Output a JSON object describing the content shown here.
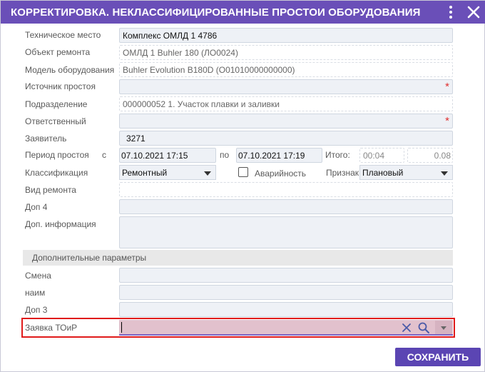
{
  "window": {
    "title": "КОРРЕКТИРОВКА. НЕКЛАССИФИЦИРОВАННЫЕ ПРОСТОИ ОБОРУДОВАНИЯ"
  },
  "fields": {
    "tech_place": {
      "label": "Техническое место",
      "value": "Комплекс ОМЛД 1 4786"
    },
    "repair_object": {
      "label": "Объект ремонта",
      "value": "ОМЛД 1 Buhler 180 (ЛО0024)"
    },
    "equipment_model": {
      "label": "Модель оборудования",
      "value": "Buhler Evolution B180D (O01010000000000)"
    },
    "downtime_source": {
      "label": "Источник простоя",
      "value": "",
      "required_mark": "*"
    },
    "department": {
      "label": "Подразделение",
      "value": "000000052 1. Участок плавки и заливки"
    },
    "responsible": {
      "label": "Ответственный",
      "value": "",
      "required_mark": "*"
    },
    "applicant": {
      "label": "Заявитель",
      "value": "3271"
    },
    "period": {
      "label": "Период простоя",
      "from_label": "с",
      "from_value": "07.10.2021 17:15",
      "to_label": "по",
      "to_value": "07.10.2021 17:19",
      "total_label": "Итого:",
      "total_time": "00:04",
      "total_hours": "0.08"
    },
    "classification": {
      "label": "Классификация",
      "value": "Ремонтный"
    },
    "emergency": {
      "label": "Аварийность",
      "checked": false
    },
    "sign": {
      "label": "Признак",
      "value": "Плановый"
    },
    "repair_type": {
      "label": "Вид ремонта",
      "value": ""
    },
    "extra4": {
      "label": "Доп 4",
      "value": ""
    },
    "extra_info": {
      "label": "Доп. информация",
      "value": ""
    }
  },
  "additional": {
    "section_title": "Дополнительные параметры",
    "shift": {
      "label": "Смена",
      "value": ""
    },
    "naim": {
      "label": "наим",
      "value": ""
    },
    "extra3": {
      "label": "Доп 3",
      "value": ""
    },
    "toir_request": {
      "label": "Заявка ТОиР",
      "value": ""
    }
  },
  "buttons": {
    "save": "СОХРАНИТЬ"
  },
  "icons": {
    "title_more": "more-vertical-icon",
    "title_close": "close-icon",
    "clear": "clear-x-icon",
    "search": "search-icon",
    "dropdown": "chevron-down-icon"
  },
  "colors": {
    "titlebar": "#6a4fb8",
    "save_button": "#5b45b3",
    "highlight": "#e01b1b",
    "required": "#e03030",
    "active_field": "#e2c1cd"
  }
}
